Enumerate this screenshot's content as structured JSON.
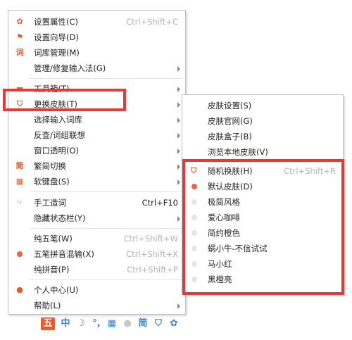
{
  "main_menu": {
    "items": [
      {
        "label": "设置属性(C)",
        "shortcut": "Ctrl+Shift+C",
        "icon": "gear-icon"
      },
      {
        "label": "设置向导(D)",
        "icon": "flag-icon"
      },
      {
        "label": "词库管理(M)",
        "icon": "ci-char-icon"
      },
      {
        "label": "管理/修复输入法(G)",
        "submenu": true
      },
      {
        "label": "工具箱(T)",
        "submenu": true,
        "icon": "toolbox-icon"
      },
      {
        "label": "更换皮肤(T)",
        "submenu": true,
        "icon": "shirt-icon"
      },
      {
        "label": "选择输入词库",
        "submenu": true
      },
      {
        "label": "反查/词组联想",
        "submenu": true
      },
      {
        "label": "窗口透明(O)",
        "submenu": true
      },
      {
        "label": "繁简切换",
        "submenu": true,
        "icon": "jian-char-icon"
      },
      {
        "label": "软键盘(S)",
        "submenu": true,
        "icon": "keyboard-icon"
      },
      {
        "label": "手工造词",
        "shortcut": "Ctrl+F10",
        "icon": "hand-icon"
      },
      {
        "label": "隐藏状态栏(Y)",
        "submenu": true
      },
      {
        "label": "纯五笔(W)",
        "shortcut": "Ctrl+Shift+W"
      },
      {
        "label": "五笔拼音混输(X)",
        "shortcut": "Ctrl+Shift+X"
      },
      {
        "label": "纯拼音(P)",
        "shortcut": "Ctrl+Shift+P"
      },
      {
        "label": "个人中心(U)",
        "icon": "person-icon"
      },
      {
        "label": "帮助(L)",
        "submenu": true
      }
    ]
  },
  "skin_menu": {
    "items": [
      {
        "label": "皮肤设置(S)"
      },
      {
        "label": "皮肤官网(G)"
      },
      {
        "label": "皮肤盒子(B)"
      },
      {
        "label": "浏览本地皮肤(V)"
      },
      {
        "label": "随机换肤(H)",
        "shortcut": "Ctrl+Shift+R"
      },
      {
        "label": "默认皮肤(D)",
        "selected": true
      },
      {
        "label": "极简风格"
      },
      {
        "label": "爱心咖啡"
      },
      {
        "label": "简约橙色"
      },
      {
        "label": "蜗小牛-不信试试"
      },
      {
        "label": "马小红"
      },
      {
        "label": "黑橙亮"
      }
    ]
  },
  "toolbar": {
    "mode": "中",
    "jian": "简"
  },
  "colors": {
    "accent": "#e9572a",
    "highlight": "#e53a3a",
    "toolbar_blue": "#3a7fd6"
  }
}
